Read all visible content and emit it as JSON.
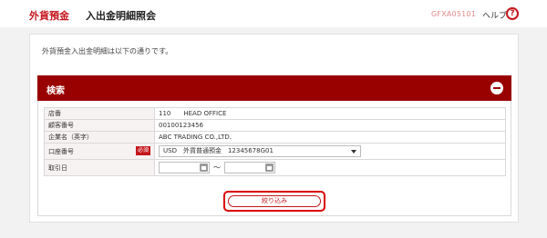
{
  "header": {
    "service_title": "外貨預金",
    "page_title": "入出金明細照会",
    "screen_code": "GFXA05101",
    "help_label": "ヘルプ",
    "help_icon_glyph": "?"
  },
  "main": {
    "intro_text": "外貨預金入出金明細は以下の通りです。",
    "search_panel": {
      "title": "検索",
      "rows": {
        "branch": {
          "label": "店番",
          "value": "110　　HEAD OFFICE"
        },
        "customer_number": {
          "label": "顧客番号",
          "value": "00100123456"
        },
        "company_name": {
          "label": "企業名（英字）",
          "value": "ABC TRADING CO.,LTD."
        },
        "account_number": {
          "label": "口座番号",
          "required_badge": "必須",
          "selected": "USD　外貨普通預金　12345678G01"
        },
        "transaction_date": {
          "label": "取引日",
          "from_value": "",
          "separator": "～",
          "to_value": ""
        }
      },
      "filter_button_label": "絞り込み"
    }
  },
  "colors": {
    "brand_red": "#c4161c",
    "panel_header": "#990000",
    "highlight_outline": "#d90000"
  }
}
